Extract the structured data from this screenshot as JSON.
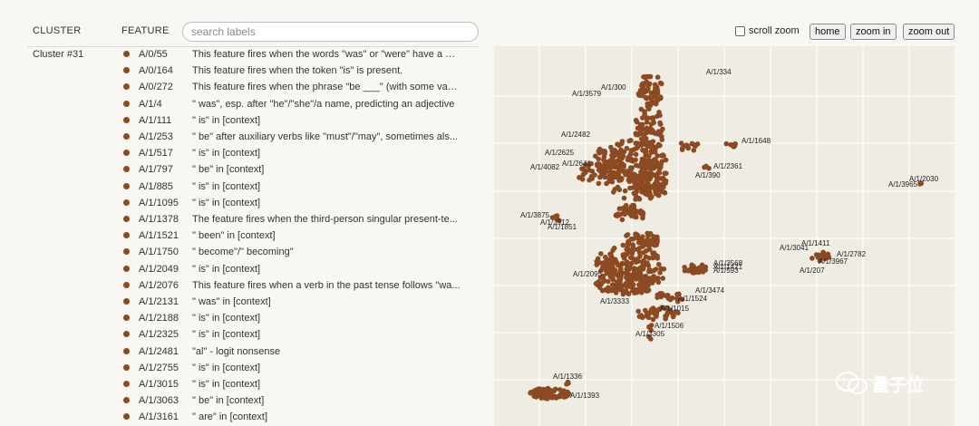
{
  "header": {
    "cluster": "CLUSTER",
    "feature": "FEATURE"
  },
  "search": {
    "placeholder": "search labels"
  },
  "cluster": {
    "name": "Cluster #31"
  },
  "features": [
    {
      "id": "A/0/55",
      "desc": "This feature fires when the words \"was\" or \"were\" have a hi..."
    },
    {
      "id": "A/0/164",
      "desc": "This feature fires when the token \"is\" is present."
    },
    {
      "id": "A/0/272",
      "desc": "This feature fires when the phrase \"be ___\" (with some vari..."
    },
    {
      "id": "A/1/4",
      "desc": "\" was\", esp. after \"he\"/\"she\"/a name, predicting an adjective"
    },
    {
      "id": "A/1/111",
      "desc": "\" is\" in [context]"
    },
    {
      "id": "A/1/253",
      "desc": "\" be\" after auxiliary verbs like \"must\"/\"may\", sometimes als..."
    },
    {
      "id": "A/1/517",
      "desc": "\" is\" in [context]"
    },
    {
      "id": "A/1/797",
      "desc": "\" be\" in [context]"
    },
    {
      "id": "A/1/885",
      "desc": "\" is\" in [context]"
    },
    {
      "id": "A/1/1095",
      "desc": "\" is\" in [context]"
    },
    {
      "id": "A/1/1378",
      "desc": "The feature fires when the third-person singular present-te..."
    },
    {
      "id": "A/1/1521",
      "desc": "\" been\" in [context]"
    },
    {
      "id": "A/1/1750",
      "desc": "\" become\"/\" becoming\""
    },
    {
      "id": "A/1/2049",
      "desc": "\" is\" in [context]"
    },
    {
      "id": "A/1/2076",
      "desc": "This feature fires when a verb in the past tense follows \"wa..."
    },
    {
      "id": "A/1/2131",
      "desc": "\" was\" in [context]"
    },
    {
      "id": "A/1/2188",
      "desc": "\" is\" in [context]"
    },
    {
      "id": "A/1/2325",
      "desc": "\" is\" in [context]"
    },
    {
      "id": "A/1/2481",
      "desc": "\"al\" - logit nonsense"
    },
    {
      "id": "A/1/2755",
      "desc": "\" is\" in [context]"
    },
    {
      "id": "A/1/3015",
      "desc": "\" is\" in [context]"
    },
    {
      "id": "A/1/3063",
      "desc": "\" be\" in [context]"
    },
    {
      "id": "A/1/3161",
      "desc": "\" are\" in [context]"
    }
  ],
  "controls": {
    "scroll_zoom": "scroll zoom",
    "scroll_zoom_checked": false,
    "home": "home",
    "zoom_in": "zoom in",
    "zoom_out": "zoom out"
  },
  "map_labels": [
    "A/1/334",
    "A/1/300",
    "A/1/3579",
    "A/1/2482",
    "A/1/1648",
    "A/1/2625",
    "A/1/2641",
    "A/1/4082",
    "A/1/2361",
    "A/1/390",
    "A/1/2030",
    "A/1/3965",
    "A/1/3875",
    "A/1/3912",
    "A/1/1851",
    "A/1/1411",
    "A/1/3041",
    "A/1/2782",
    "A/1/3967",
    "A/1/207",
    "A/1/3568",
    "A/1/1421",
    "A/1/593",
    "A/1/2095",
    "A/1/3474",
    "A/1/1524",
    "A/1/3333",
    "A/1/1015",
    "A/1/1506",
    "A/1/3305",
    "A/1/1336",
    "A/1/1393"
  ],
  "colors": {
    "point": "#8b4a22",
    "map_bg": "#efece4",
    "grid": "#ffffff"
  },
  "watermark": {
    "text": "量子位",
    "icon": "wechat-icon"
  }
}
